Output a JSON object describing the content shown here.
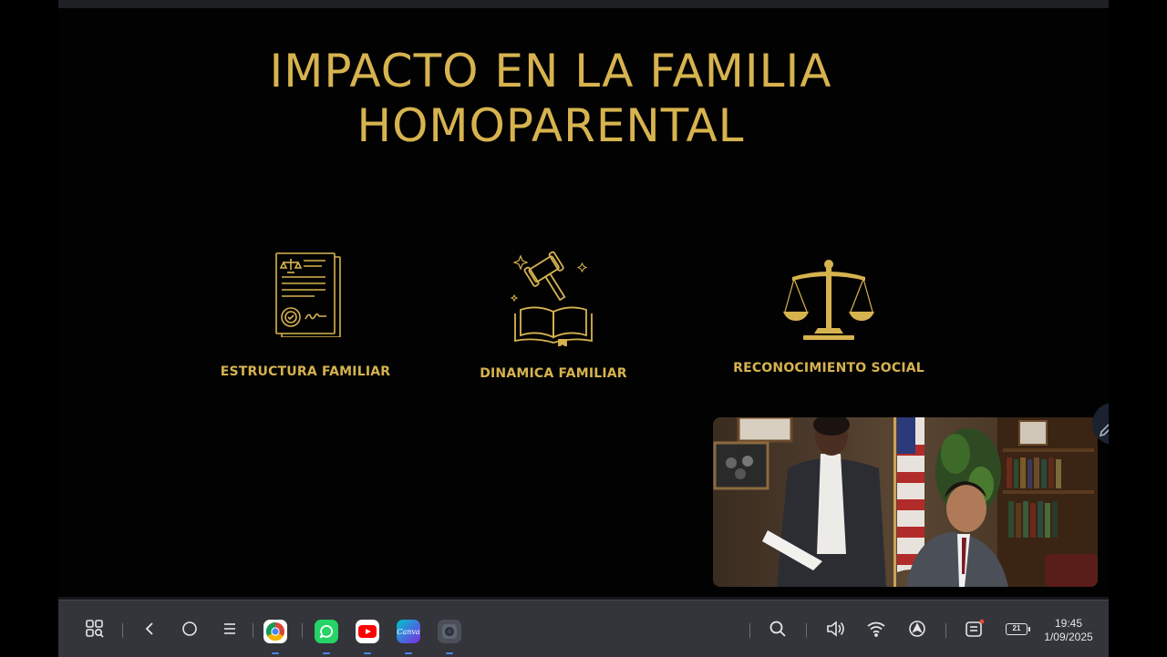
{
  "slide": {
    "title_line1": "IMPACTO EN LA FAMILIA",
    "title_line2": "HOMOPARENTAL",
    "features": [
      {
        "label": "ESTRUCTURA FAMILIAR",
        "icon": "legal-document-icon"
      },
      {
        "label": "DINAMICA FAMILIAR",
        "icon": "gavel-book-icon"
      },
      {
        "label": "RECONOCIMIENTO SOCIAL",
        "icon": "scales-of-justice-icon"
      }
    ],
    "accent_color": "#d7b34f"
  },
  "video_overlay": {
    "icon": "legal-office-video-thumbnail"
  },
  "taskbar": {
    "icons": [
      "apps-search-icon",
      "back-icon",
      "home-icon",
      "recents-icon",
      "chrome-icon",
      "whatsapp-icon",
      "youtube-icon",
      "canva-icon",
      "camera-app-icon",
      "search-icon",
      "volume-icon",
      "wifi-icon",
      "navigation-icon",
      "notifications-icon",
      "battery-icon"
    ],
    "canva_label": "Canva",
    "battery_level": "21",
    "time": "19:45",
    "date": "1/09/2025"
  }
}
